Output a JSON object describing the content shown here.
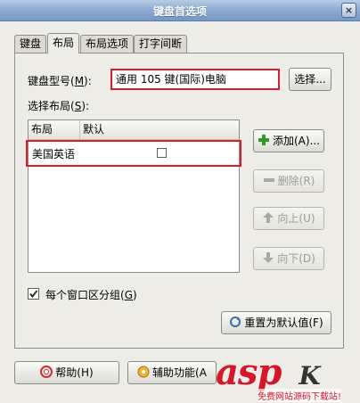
{
  "window": {
    "title": "键盘首选项",
    "close_glyph": "×"
  },
  "tabs": [
    {
      "label": "键盘"
    },
    {
      "label": "布局",
      "active": true
    },
    {
      "label": "布局选项"
    },
    {
      "label": "打字间断"
    }
  ],
  "model": {
    "label": "键盘型号(",
    "mnemonic": "M",
    "label_end": "):",
    "value": "通用 105 键(国际)电脑",
    "select_button": "选择..."
  },
  "layouts": {
    "label": "选择布局(",
    "mnemonic": "S",
    "label_end": "):",
    "columns": [
      "布局",
      "默认"
    ],
    "rows": [
      {
        "name": "美国英语",
        "default": false
      }
    ]
  },
  "actions": {
    "add": "添加(A)...",
    "remove": "删除(R)",
    "move_up": "向上(U)",
    "move_down": "向下(D)"
  },
  "grouping": {
    "label": "每个窗口区分组(",
    "mnemonic": "G",
    "label_end": ")",
    "checked": true
  },
  "reset_button": "重置为默认值(F)",
  "footer": {
    "help": "帮助(H)",
    "accessibility": "辅助功能(A"
  },
  "watermark": {
    "brand": "asp",
    "suffix": "K",
    "subtitle": "免费网站源码下载站!"
  },
  "colors": {
    "highlight": "#d81e2c",
    "add_icon": "#2f9b2f",
    "title_bar": "#8fadd2"
  },
  "icons": [
    "close-icon",
    "add-icon",
    "remove-icon",
    "arrow-up-icon",
    "arrow-down-icon",
    "check-icon",
    "reset-icon",
    "help-icon",
    "accessibility-icon"
  ]
}
